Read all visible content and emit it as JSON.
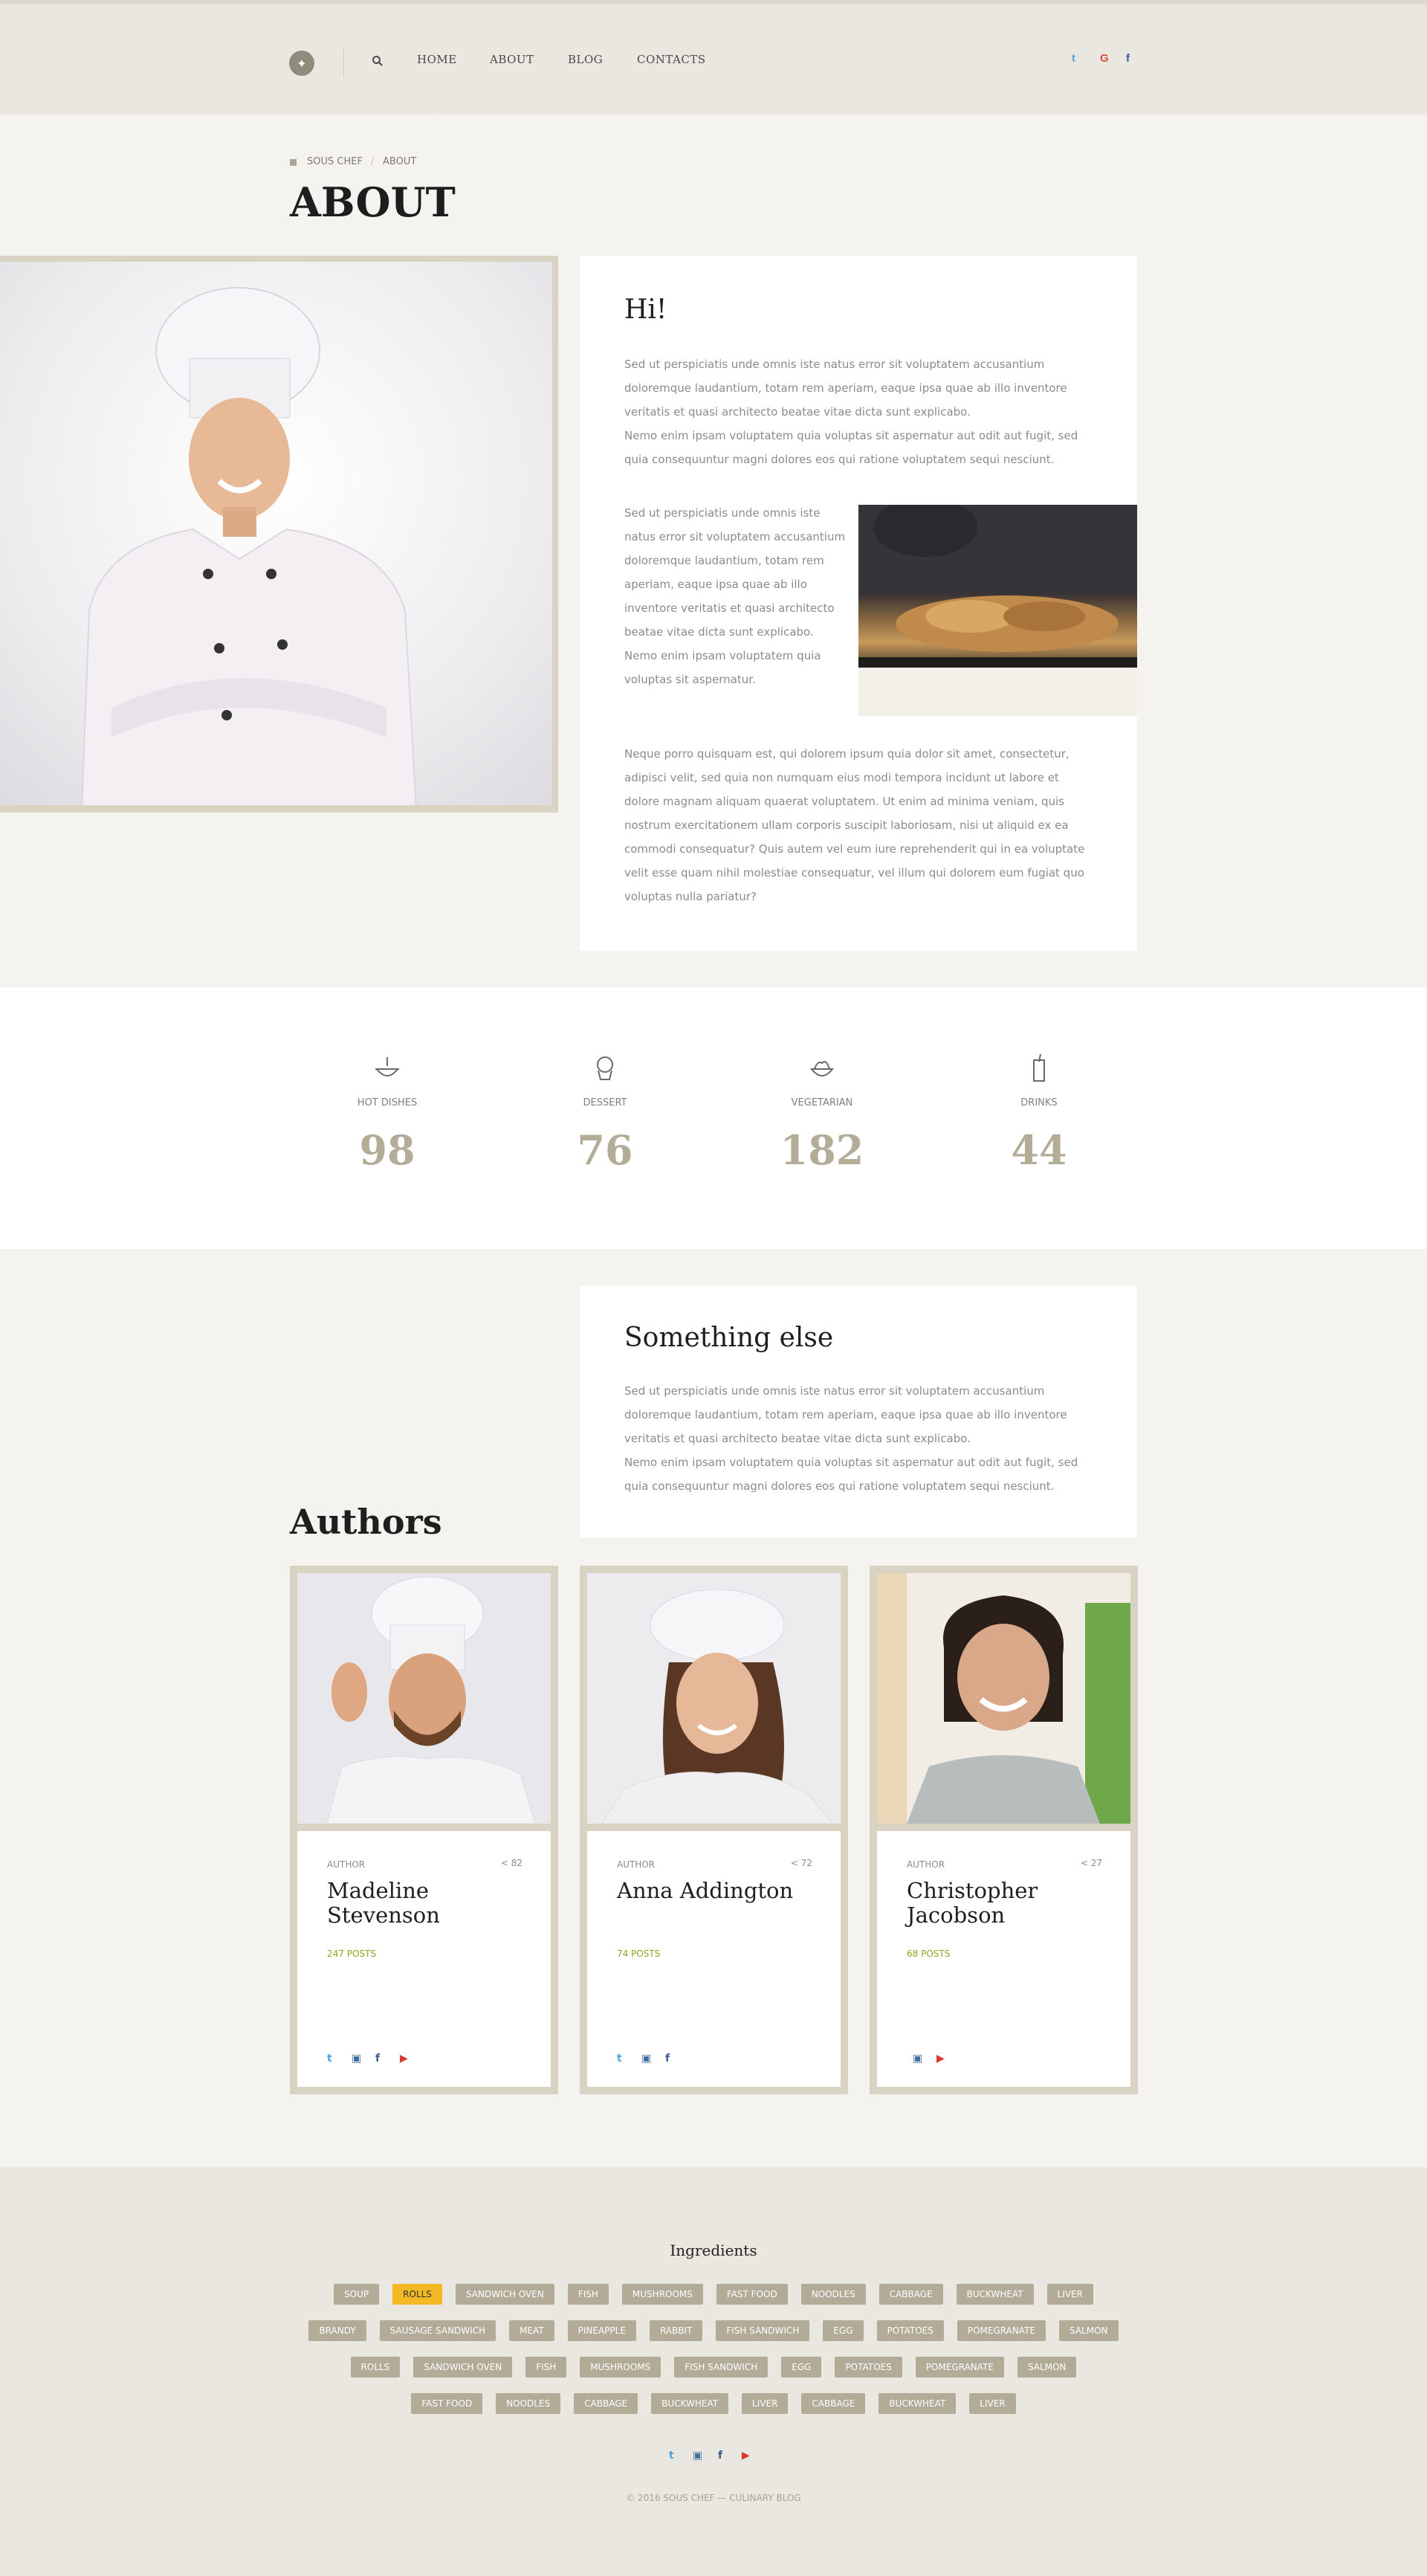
{
  "header": {
    "logo_icon": "utensils-icon",
    "search_icon": "search-icon",
    "nav": [
      "HOME",
      "ABOUT",
      "BLOG",
      "CONTACTS"
    ],
    "social": [
      {
        "icon": "twitter-icon",
        "glyph": "t",
        "color": "#4aa3df"
      },
      {
        "icon": "google-plus-icon",
        "glyph": "G",
        "color": "#e04a3a"
      },
      {
        "icon": "facebook-icon",
        "glyph": "f",
        "color": "#3b5998"
      }
    ]
  },
  "breadcrumb": {
    "home": "SOUS CHEF",
    "sep": "/",
    "current": "ABOUT"
  },
  "page_title": "ABOUT",
  "intro": {
    "heading": "Hi!",
    "para1": "Sed ut perspiciatis unde omnis iste natus error sit voluptatem accusantium doloremque laudantium, totam rem aperiam, eaque ipsa quae ab illo inventore veritatis et quasi architecto beatae vitae dicta sunt explicabo.",
    "para1b": "Nemo enim ipsam voluptatem quia voluptas sit aspernatur aut odit aut fugit, sed quia consequuntur magni dolores eos qui ratione voluptatem sequi nesciunt.",
    "para2": "Sed ut perspiciatis unde omnis iste natus error sit voluptatem accusantium doloremque laudantium, totam rem aperiam, eaque ipsa quae ab illo inventore veritatis et quasi architecto beatae vitae dicta sunt explicabo.",
    "para2b": "Nemo enim ipsam voluptatem quia voluptas sit aspernatur.",
    "para3": "Neque porro quisquam est, qui dolorem ipsum quia dolor sit amet, consectetur, adipisci velit, sed quia non numquam eius modi tempora incidunt ut labore et dolore magnam aliquam quaerat voluptatem. Ut enim ad minima veniam, quis nostrum exercitationem ullam corporis suscipit laboriosam, nisi ut aliquid ex ea commodi consequatur? Quis autem vel eum iure reprehenderit qui in ea voluptate velit esse quam nihil molestiae consequatur, vel illum qui dolorem eum fugiat quo voluptas nulla pariatur?"
  },
  "stats": [
    {
      "label": "HOT DISHES",
      "value": "98",
      "icon": "bowl-icon"
    },
    {
      "label": "DESSERT",
      "value": "76",
      "icon": "cupcake-icon"
    },
    {
      "label": "VEGETARIAN",
      "value": "182",
      "icon": "salad-icon"
    },
    {
      "label": "DRINKS",
      "value": "44",
      "icon": "drink-icon"
    }
  ],
  "something": {
    "heading": "Something else",
    "para1": "Sed ut perspiciatis unde omnis iste natus error sit voluptatem accusantium doloremque laudantium, totam rem aperiam, eaque ipsa quae ab illo inventore veritatis et quasi architecto beatae vitae dicta sunt explicabo.",
    "para2": "Nemo enim ipsam voluptatem quia voluptas sit aspernatur aut odit aut fugit, sed quia consequuntur magni dolores eos qui ratione voluptatem sequi nesciunt."
  },
  "authors_title": "Authors",
  "authors": [
    {
      "role": "AUTHOR",
      "shares": "82",
      "name": "Madeline Stevenson",
      "posts": "247 POSTS"
    },
    {
      "role": "AUTHOR",
      "shares": "72",
      "name": "Anna Addington",
      "posts": "74 POSTS"
    },
    {
      "role": "AUTHOR",
      "shares": "27",
      "name": "Christopher Jacobson",
      "posts": "68 POSTS"
    }
  ],
  "footer": {
    "ingredients_title": "Ingredients",
    "tag_rows": [
      [
        "SOUP",
        "ROLLS",
        "SANDWICH OVEN",
        "FISH",
        "MUSHROOMS",
        "FAST FOOD",
        "NOODLES",
        "CABBAGE",
        "BUCKWHEAT",
        "LIVER"
      ],
      [
        "BRANDY",
        "SAUSAGE SANDWICH",
        "MEAT",
        "PINEAPPLE",
        "RABBIT",
        "FISH SANDWICH",
        "EGG",
        "POTATOES",
        "POMEGRANATE",
        "SALMON"
      ],
      [
        "ROLLS",
        "SANDWICH OVEN",
        "FISH",
        "MUSHROOMS",
        "FISH SANDWICH",
        "EGG",
        "POTATOES",
        "POMEGRANATE",
        "SALMON"
      ],
      [
        "FAST FOOD",
        "NOODLES",
        "CABBAGE",
        "BUCKWHEAT",
        "LIVER",
        "CABBAGE",
        "BUCKWHEAT",
        "LIVER"
      ]
    ],
    "active_tag": "ROLLS",
    "copyright": "© 2016 SOUS CHEF — CULINARY BLOG"
  },
  "colors": {
    "accent": "#f3b823",
    "tag": "#b1ab98",
    "posts": "#8ca51d",
    "stat": "#b3ad98"
  }
}
